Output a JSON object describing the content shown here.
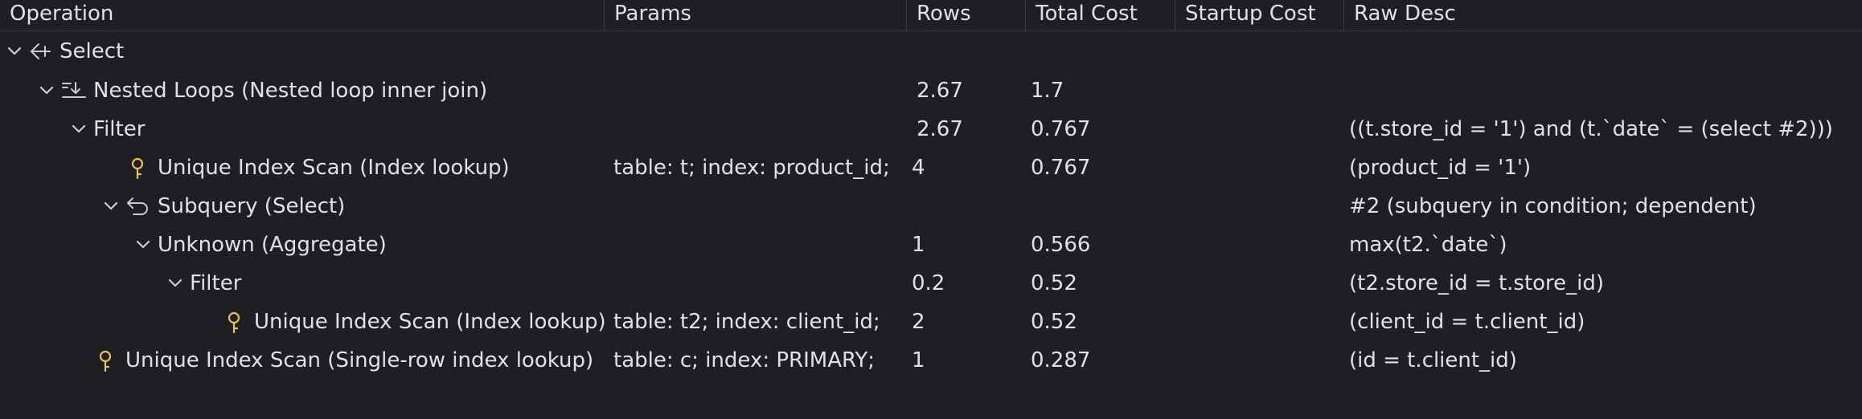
{
  "columns": [
    "Operation",
    "Params",
    "Rows",
    "Total Cost",
    "Startup Cost",
    "Raw Desc"
  ],
  "rows": [
    {
      "operation": "Select",
      "params": "",
      "rows": "",
      "total_cost": "",
      "startup_cost": "",
      "raw_desc": "",
      "icon": "select-arrow-icon"
    },
    {
      "operation": "Nested Loops (Nested loop inner join)",
      "params": "",
      "rows": "2.67",
      "total_cost": "1.7",
      "startup_cost": "",
      "raw_desc": "",
      "icon": "nested-loops-icon"
    },
    {
      "operation": "Filter",
      "params": "",
      "rows": "2.67",
      "total_cost": "0.767",
      "startup_cost": "",
      "raw_desc": "((t.store_id = '1') and (t.`date` = (select #2)))",
      "icon": ""
    },
    {
      "operation": "Unique Index Scan (Index lookup)",
      "params": "table: t; index: product_id;",
      "rows": "4",
      "total_cost": "0.767",
      "startup_cost": "",
      "raw_desc": "(product_id = '1')",
      "icon": "key-icon"
    },
    {
      "operation": "Subquery (Select)",
      "params": "",
      "rows": "",
      "total_cost": "",
      "startup_cost": "",
      "raw_desc": "#2 (subquery in condition; dependent)",
      "icon": "subquery-icon"
    },
    {
      "operation": "Unknown (Aggregate)",
      "params": "",
      "rows": "1",
      "total_cost": "0.566",
      "startup_cost": "",
      "raw_desc": "max(t2.`date`)",
      "icon": ""
    },
    {
      "operation": "Filter",
      "params": "",
      "rows": "0.2",
      "total_cost": "0.52",
      "startup_cost": "",
      "raw_desc": "(t2.store_id = t.store_id)",
      "icon": ""
    },
    {
      "operation": "Unique Index Scan (Index lookup)",
      "params": "table: t2; index: client_id;",
      "rows": "2",
      "total_cost": "0.52",
      "startup_cost": "",
      "raw_desc": "(client_id = t.client_id)",
      "icon": "key-icon"
    },
    {
      "operation": "Unique Index Scan (Single-row index lookup)",
      "params": "table: c; index: PRIMARY;",
      "rows": "1",
      "total_cost": "0.287",
      "startup_cost": "",
      "raw_desc": "(id = t.client_id)",
      "icon": "key-icon"
    }
  ],
  "colors": {
    "background": "#1e1f22",
    "text": "#dfe1e5",
    "border": "#393b40",
    "key_icon": "#e8c15c"
  }
}
